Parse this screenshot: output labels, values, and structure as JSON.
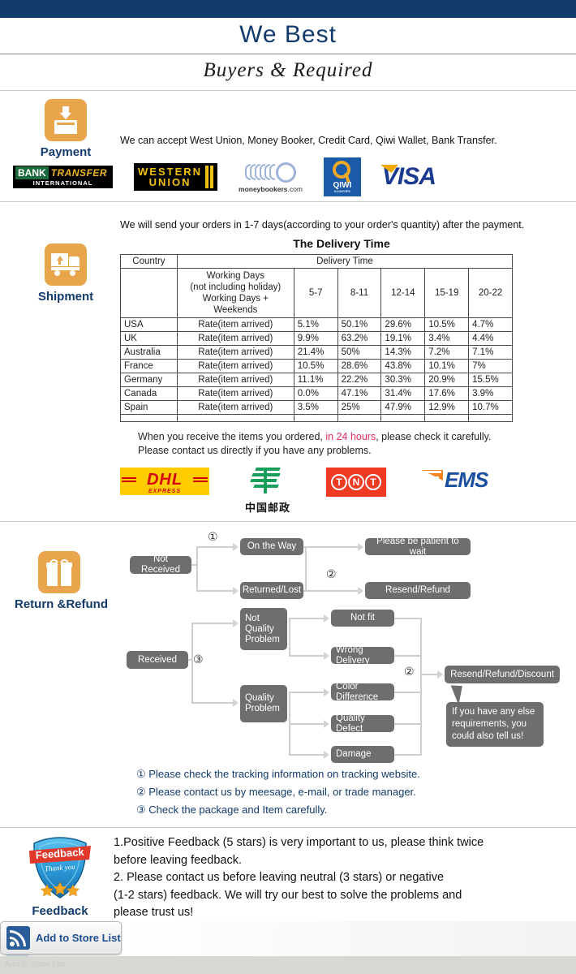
{
  "header": {
    "title": "We   Best",
    "script_line": "Buyers & Required"
  },
  "payment": {
    "icon_name": "payment-inbox-icon",
    "label": "Payment",
    "text": "We can accept West Union, Money Booker, Credit Card, Qiwi Wallet, Bank Transfer.",
    "logos": [
      {
        "name": "bank-transfer-logo",
        "line1a": "BANK",
        "line1b": "TRANSFER",
        "line2": "INTERNATIONAL"
      },
      {
        "name": "western-union-logo",
        "line1": "WESTERN",
        "line2": "UNION"
      },
      {
        "name": "moneybookers-logo",
        "line1": "moneybookers",
        "line2": ".com"
      },
      {
        "name": "qiwi-logo",
        "line1": "QIWI",
        "line2": "КОШЕЛЕК"
      },
      {
        "name": "visa-logo",
        "line1": "VISA"
      }
    ]
  },
  "shipment": {
    "icon_name": "shipment-truck-icon",
    "label": "Shipment",
    "lead": "We will send your orders in 1-7 days(according to your order's quantity) after the payment.",
    "table_title": "The Delivery Time",
    "table": {
      "col_country": "Country",
      "col_delivery_time": "Delivery Time",
      "working_days_lines": [
        "Working Days",
        "(not including holiday)",
        "Working Days + Weekends"
      ],
      "buckets": [
        "5-7",
        "8-11",
        "12-14",
        "15-19",
        "20-22"
      ],
      "rate_label": "Rate(item arrived)",
      "rows": [
        {
          "country": "USA",
          "rate_label": "Rate(item arrived)",
          "values": [
            "5.1%",
            "50.1%",
            "29.6%",
            "10.5%",
            "4.7%"
          ]
        },
        {
          "country": "UK",
          "rate_label": "Rate(item arrived)",
          "values": [
            "9.9%",
            "63.2%",
            "19.1%",
            "3.4%",
            "4.4%"
          ]
        },
        {
          "country": "Australia",
          "rate_label": "Rate(item arrived)",
          "values": [
            "21.4%",
            "50%",
            "14.3%",
            "7.2%",
            "7.1%"
          ]
        },
        {
          "country": "France",
          "rate_label": "Rate(item arrived)",
          "values": [
            "10.5%",
            "28.6%",
            "43.8%",
            "10.1%",
            "7%"
          ]
        },
        {
          "country": "Germany",
          "rate_label": "Rate(item arrived)",
          "values": [
            "11.1%",
            "22.2%",
            "30.3%",
            "20.9%",
            "15.5%"
          ]
        },
        {
          "country": "Canada",
          "rate_label": "Rate(item arrived)",
          "values": [
            "0.0%",
            "47.1%",
            "31.4%",
            "17.6%",
            "3.9%"
          ]
        },
        {
          "country": "Spain",
          "rate_label": "Rate(item arrived)",
          "values": [
            "3.5%",
            "25%",
            "47.9%",
            "12.9%",
            "10.7%"
          ]
        }
      ]
    },
    "note_before": "When you receive the items you ordered, ",
    "note_highlight": "in 24 hours",
    "note_after": ", please check it carefully. Please contact us directly if you have any problems.",
    "couriers": [
      {
        "name": "dhl-logo",
        "line1": "DHL",
        "line2": "EXPRESS"
      },
      {
        "name": "china-post-logo",
        "line1": "中国邮政"
      },
      {
        "name": "tnt-logo",
        "line1": "TNT"
      },
      {
        "name": "ems-logo",
        "line1": "EMS"
      }
    ]
  },
  "return_refund": {
    "icon_name": "gift-icon",
    "label": "Return &Refund",
    "flow1": {
      "start": "Not Received",
      "marker1": "①",
      "marker2": "②",
      "branch_a": "On the Way",
      "branch_b": "Returned/Lost",
      "result_a": "Please be patient to wait",
      "result_b": "Resend/Refund"
    },
    "flow2": {
      "start": "Received",
      "marker3": "③",
      "marker2": "②",
      "group_a": "Not\nQuality\nProblem",
      "group_a_l1": "Not",
      "group_a_l2": "Quality",
      "group_a_l3": "Problem",
      "group_b_l1": "Quality",
      "group_b_l2": "Problem",
      "a_items": [
        "Not fit",
        "Wrong Delivery"
      ],
      "b_items": [
        "Color Difference",
        "Quality Defect",
        "Damage"
      ],
      "result": "Resend/Refund/Discount",
      "bubble": "If you have any else requirements, you could also tell us!"
    },
    "notes": [
      "① Please check the tracking information on tracking website.",
      "② Please contact us by meesage, e-mail, or trade manager.",
      "③ Check the package and Item carefully."
    ]
  },
  "feedback": {
    "icon_name": "feedback-shield-icon",
    "badge_line1": "Feedback",
    "badge_line2": "Thank you",
    "label": "Feedback",
    "lines": [
      "1.Positive Feedback (5 stars) is very important to us, please think twice",
      " before leaving feedback.",
      "2. Please contact us before leaving neutral (3 stars) or negative",
      "(1-2 stars) feedback. We will try our best to solve the problems and",
      " please trust us!"
    ]
  },
  "store": {
    "button_label": "Add to Store List",
    "icon_name": "rss-icon"
  },
  "colors": {
    "navy": "#123a6b",
    "orange": "#e8a54b",
    "node_gray": "#6e6e6e",
    "line_gray": "#cfcfcf",
    "red_highlight": "#e2295b"
  }
}
